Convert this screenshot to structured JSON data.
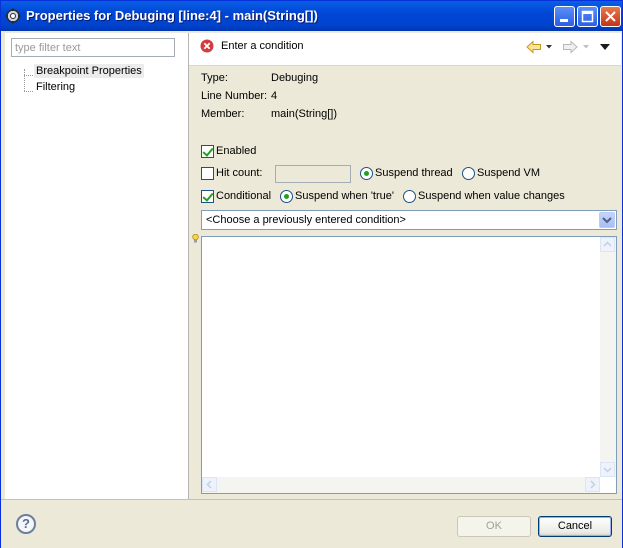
{
  "window": {
    "title": "Properties for Debuging [line:4] - main(String[])",
    "icons": {
      "app": "gear-icon",
      "min": "minimize-icon",
      "max": "maximize-icon",
      "close": "close-icon"
    }
  },
  "sidebar": {
    "filter_placeholder": "type filter text",
    "items": [
      {
        "label": "Breakpoint Properties",
        "selected": true
      },
      {
        "label": "Filtering",
        "selected": false
      }
    ]
  },
  "message": {
    "text": "Enter a condition",
    "icon": "error-icon"
  },
  "info": {
    "type_label": "Type:",
    "type_value": "Debuging",
    "line_label": "Line Number:",
    "line_value": "4",
    "member_label": "Member:",
    "member_value": "main(String[])"
  },
  "options": {
    "enabled_label": "Enabled",
    "enabled": true,
    "hitcount_label": "Hit count:",
    "hitcount": false,
    "hitcount_value": "",
    "suspend_thread_label": "Suspend thread",
    "suspend_vm_label": "Suspend VM",
    "suspend_choice": "thread",
    "conditional_label": "Conditional",
    "conditional": true,
    "suspend_true_label": "Suspend when 'true'",
    "suspend_changes_label": "Suspend when value changes",
    "condition_choice": "true"
  },
  "condition_combo": {
    "value": "<Choose a previously entered condition>"
  },
  "footer": {
    "help_label": "?",
    "ok_label": "OK",
    "cancel_label": "Cancel"
  },
  "colors": {
    "titlebar": "#0046d5",
    "check": "#21a121",
    "error": "#d33c3c"
  }
}
